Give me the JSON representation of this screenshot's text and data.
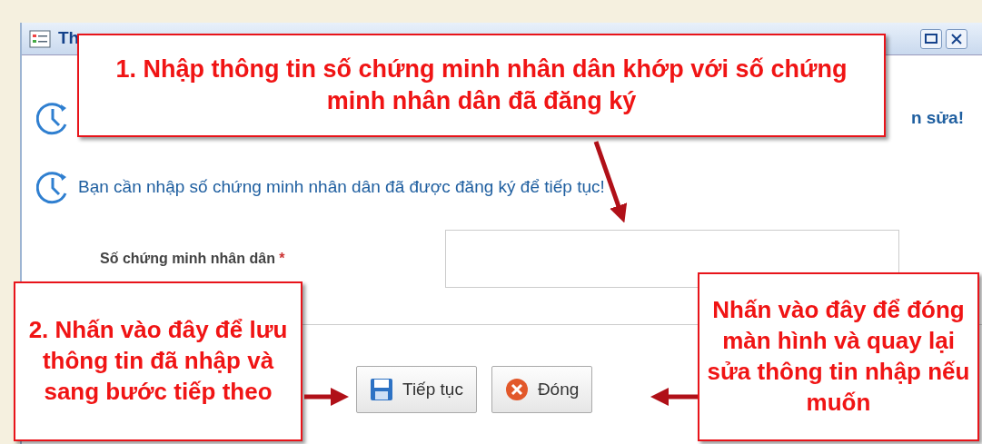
{
  "window": {
    "title": "Th"
  },
  "messages": [
    {
      "text": "n sửa!"
    },
    {
      "text": "Bạn cần nhập số chứng minh nhân dân đã được đăng ký để tiếp tục!"
    }
  ],
  "field": {
    "label": "Số chứng minh nhân dân",
    "required_mark": "*"
  },
  "buttons": [
    {
      "label": "Tiếp tục",
      "kind": "save"
    },
    {
      "label": "Đóng",
      "kind": "close"
    }
  ],
  "callouts": [
    {
      "text": "1. Nhập thông tin số chứng minh nhân dân khớp với số chứng minh nhân dân đã đăng ký",
      "kind": "top"
    },
    {
      "text": "2. Nhấn vào đây để lưu thông tin đã nhập và sang bước tiếp theo",
      "kind": "left"
    },
    {
      "text": "Nhấn vào đây để đóng màn hình và quay lại sửa thông tin nhập nếu muốn",
      "kind": "right"
    }
  ]
}
